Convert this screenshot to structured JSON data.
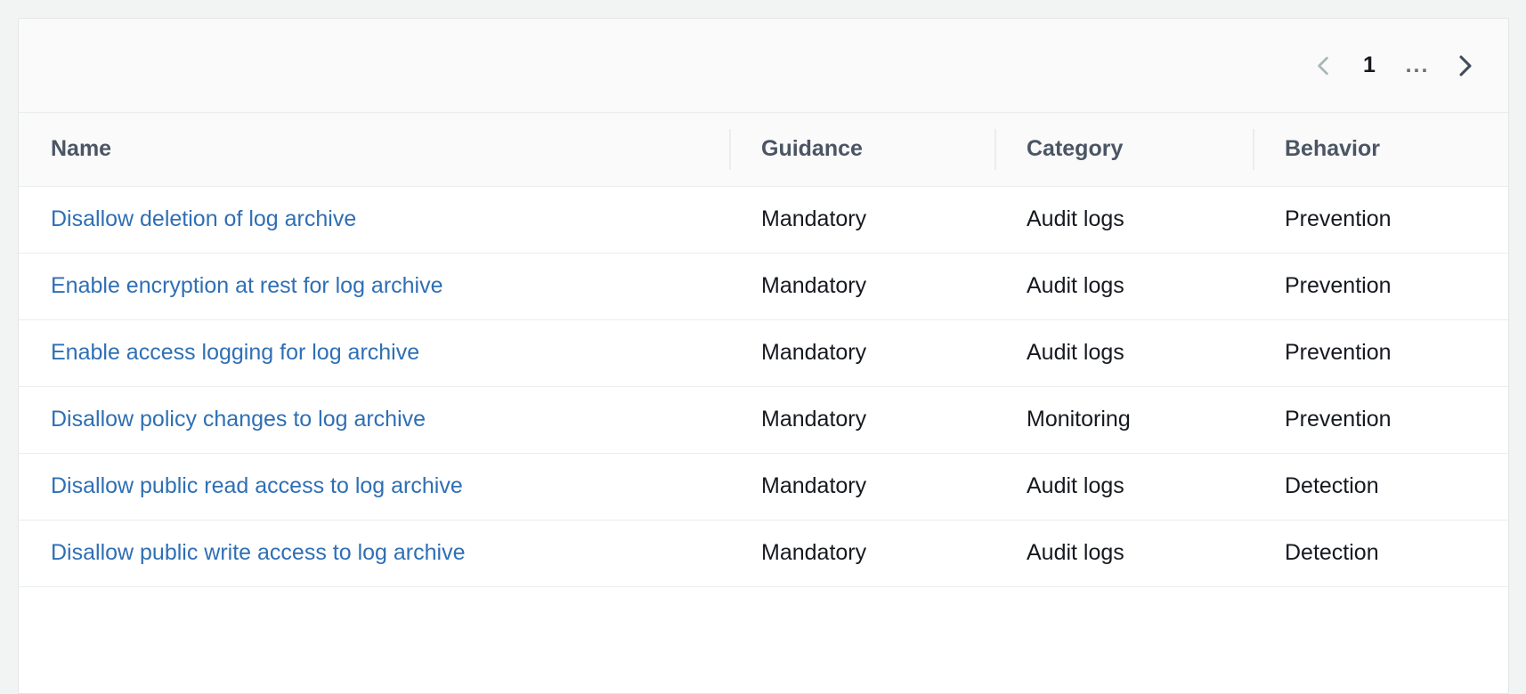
{
  "colors": {
    "page_background": "#f2f3f3",
    "container_background": "#ffffff",
    "header_background": "#fafafa",
    "border": "#eaeded",
    "link": "#2f6fb4",
    "header_text": "#4b5563",
    "cell_text": "#16191f",
    "chevron_disabled": "#aab7b8",
    "chevron_enabled": "#414d5c"
  },
  "pagination": {
    "previous_label": "Previous page",
    "next_label": "Next page",
    "current_page": "1",
    "ellipsis": "...",
    "previous_icon": "chevron-left-icon",
    "next_icon": "chevron-right-icon",
    "previous_enabled": false,
    "next_enabled": true
  },
  "table": {
    "columns": [
      {
        "key": "name",
        "label": "Name"
      },
      {
        "key": "guidance",
        "label": "Guidance"
      },
      {
        "key": "category",
        "label": "Category"
      },
      {
        "key": "behavior",
        "label": "Behavior"
      }
    ],
    "rows": [
      {
        "name": "Disallow deletion of log archive",
        "guidance": "Mandatory",
        "category": "Audit logs",
        "behavior": "Prevention"
      },
      {
        "name": "Enable encryption at rest for log archive",
        "guidance": "Mandatory",
        "category": "Audit logs",
        "behavior": "Prevention"
      },
      {
        "name": "Enable access logging for log archive",
        "guidance": "Mandatory",
        "category": "Audit logs",
        "behavior": "Prevention"
      },
      {
        "name": "Disallow policy changes to log archive",
        "guidance": "Mandatory",
        "category": "Monitoring",
        "behavior": "Prevention"
      },
      {
        "name": "Disallow public read access to log archive",
        "guidance": "Mandatory",
        "category": "Audit logs",
        "behavior": "Detection"
      },
      {
        "name": "Disallow public write access to log archive",
        "guidance": "Mandatory",
        "category": "Audit logs",
        "behavior": "Detection"
      }
    ]
  }
}
